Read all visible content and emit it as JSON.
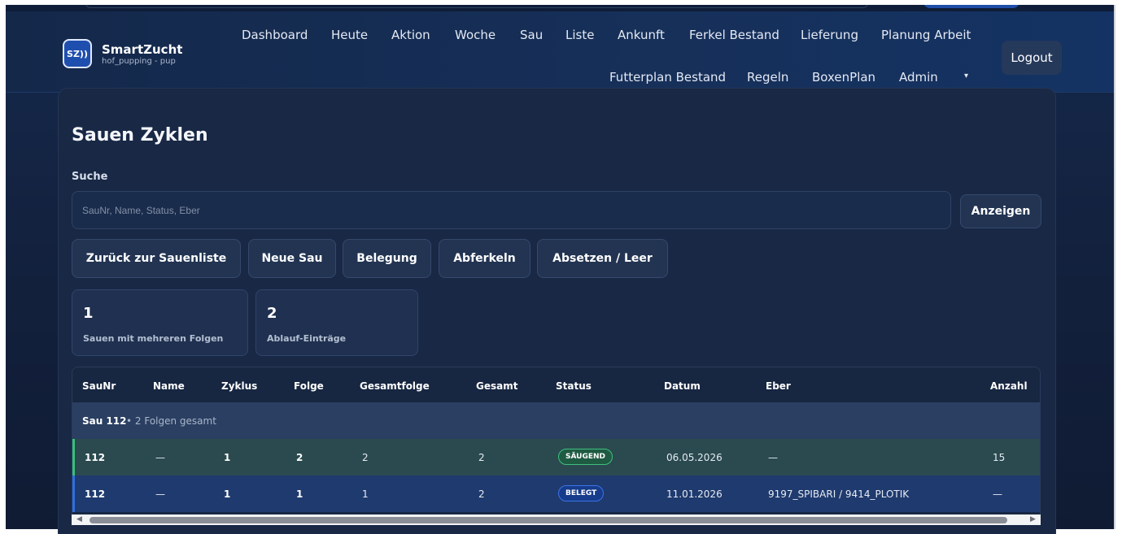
{
  "brand": {
    "logo_text": "SZ))",
    "name": "SmartZucht",
    "subtitle": "hof_pupping - pup"
  },
  "nav": {
    "row1": [
      "Dashboard",
      "Heute",
      "Aktion",
      "Woche",
      "Sau",
      "Liste",
      "Ankunft",
      "Ferkel Bestand",
      "Lieferung",
      "Planung Arbeit"
    ],
    "row2": [
      "Futterplan Bestand",
      "Regeln",
      "BoxenPlan",
      "Admin"
    ],
    "dropdown_caret": "▾",
    "logout": "Logout"
  },
  "page": {
    "title": "Sauen Zyklen"
  },
  "search": {
    "label": "Suche",
    "placeholder": "SauNr, Name, Status, Eber",
    "value": "",
    "submit": "Anzeigen"
  },
  "actions": [
    "Zurück zur Sauenliste",
    "Neue Sau",
    "Belegung",
    "Abferkeln",
    "Absetzen / Leer"
  ],
  "stats": [
    {
      "value": "1",
      "label": "Sauen mit mehreren Folgen"
    },
    {
      "value": "2",
      "label": "Ablauf-Einträge"
    }
  ],
  "table": {
    "columns": [
      "SauNr",
      "Name",
      "Zyklus",
      "Folge",
      "Gesamtfolge",
      "Gesamt",
      "Status",
      "Datum",
      "Eber",
      "Anzahl"
    ],
    "group": {
      "title": "Sau 112",
      "summary": "• 2 Folgen gesamt"
    },
    "rows": [
      {
        "saunr": "112",
        "name": "—",
        "zyklus": "1",
        "folge": "2",
        "gesamtfolge": "2",
        "gesamt": "2",
        "status": "SÄUGEND",
        "datum": "06.05.2026",
        "eber": "—",
        "anzahl": "15"
      },
      {
        "saunr": "112",
        "name": "—",
        "zyklus": "1",
        "folge": "1",
        "gesamtfolge": "1",
        "gesamt": "2",
        "status": "BELEGT",
        "datum": "11.01.2026",
        "eber": "9197_SPIBARI / 9414_PLOTIK",
        "anzahl": "—"
      }
    ]
  },
  "colors": {
    "row_saeugend_bg": "#2a4a4f",
    "row_saeugend_accent": "#3bbf7a",
    "row_belegt_bg": "#1f3a6e",
    "row_belegt_accent": "#2f6fe0",
    "badge_saeugend_bg": "#1f5a43",
    "badge_saeugend_border": "#3fbf7f",
    "badge_belegt_bg": "#173c8c",
    "badge_belegt_border": "#3b73e6"
  },
  "scrollbar": {
    "left_arrow": "◀",
    "right_arrow": "▶"
  }
}
